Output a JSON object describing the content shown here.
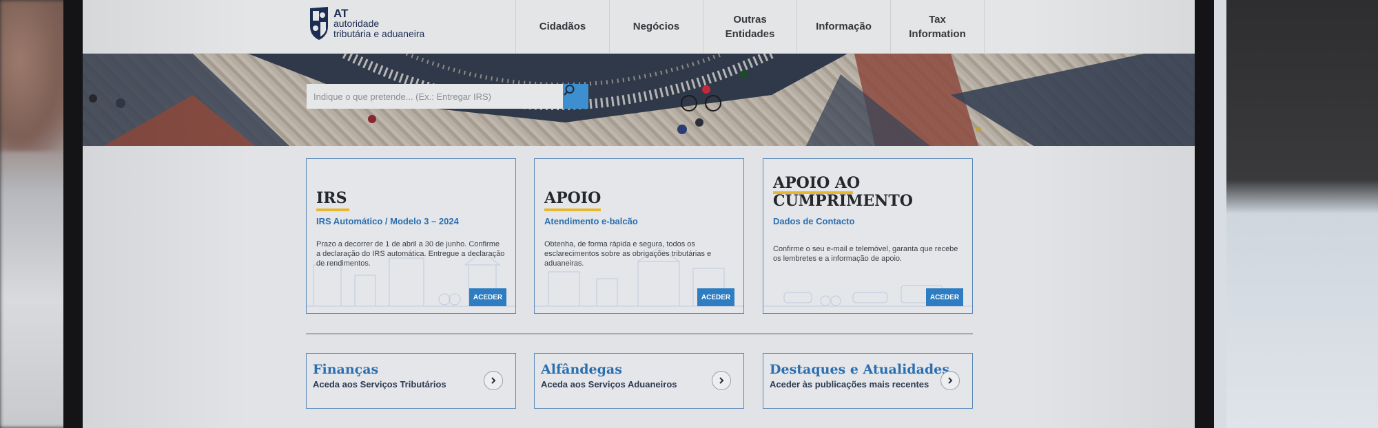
{
  "brand": {
    "logo_mark": "shield-logo-icon",
    "at": "AT",
    "line1": "autoridade",
    "line2": "tributária e aduaneira"
  },
  "nav": [
    {
      "label": "Cidadãos"
    },
    {
      "label": "Negócios"
    },
    {
      "label": "Outras\nEntidades"
    },
    {
      "label": "Informação"
    },
    {
      "label": "Tax\nInformation"
    }
  ],
  "search": {
    "placeholder": "Indique o que pretende... (Ex.: Entregar IRS)",
    "icon": "search-icon"
  },
  "cards": [
    {
      "title": "IRS",
      "subtitle": "IRS Automático / Modelo 3 – 2024",
      "description": "Prazo a decorrer de 1 de abril a 30 de junho. Confirme a declaração do IRS automática. Entregue a declaração de rendimentos.",
      "button": "ACEDER"
    },
    {
      "title": "APOIO",
      "subtitle": "Atendimento e-balcão",
      "description": "Obtenha, de forma rápida e segura, todos os esclarecimentos sobre as obrigações tributárias e aduaneiras.",
      "button": "ACEDER"
    },
    {
      "title": "APOIO AO\nCUMPRIMENTO",
      "subtitle": "Dados de Contacto",
      "description": "Confirme o seu e-mail e telemóvel, garanta que recebe os lembretes e a informação de apoio.",
      "button": "ACEDER"
    }
  ],
  "links": [
    {
      "title": "Finanças",
      "subtitle": "Aceda aos Serviços Tributários",
      "icon": "chevron-right-icon"
    },
    {
      "title": "Alfândegas",
      "subtitle": "Aceda aos Serviços Aduaneiros",
      "icon": "chevron-right-icon"
    },
    {
      "title": "Destaques e Atualidades",
      "subtitle": "Aceder às publicações mais recentes",
      "icon": "chevron-right-icon"
    }
  ],
  "colors": {
    "accent_blue": "#2c6fb0",
    "button_blue": "#2e7dc2",
    "underline_yellow": "#e7b82f",
    "brand_navy": "#1c2c52"
  }
}
